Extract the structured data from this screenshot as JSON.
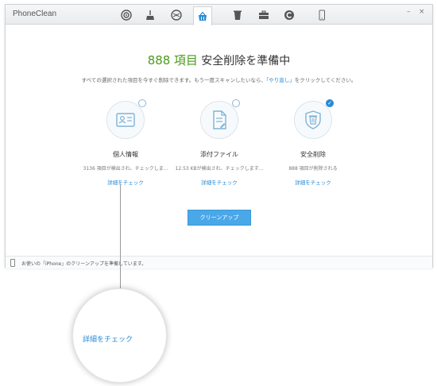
{
  "app": {
    "title": "PhoneClean"
  },
  "toolbar": {
    "tools": [
      {
        "icon": "target-icon"
      },
      {
        "icon": "broom-icon"
      },
      {
        "icon": "globe-icon"
      },
      {
        "icon": "basket-icon",
        "active": true
      },
      {
        "icon": "trash-icon"
      },
      {
        "icon": "toolbox-icon"
      },
      {
        "icon": "refresh-c-icon"
      }
    ],
    "device_icon": "phone-icon",
    "window_controls": {
      "minimize": "–",
      "close": "×"
    }
  },
  "headline": {
    "count": "888",
    "unit": "項目",
    "text": "安全削除を準備中"
  },
  "subtitle": {
    "before": "すべての選択された項目を今すぐ削除できます。もう一度スキャンしたいなら、",
    "link": "「やり直し」",
    "after": "をクリックしてください。"
  },
  "columns": [
    {
      "title": "個人情報",
      "desc": "3136 項目が検出され、チェックしま...",
      "link": "詳細をチェック",
      "icon": "contact-card-icon",
      "checked": false
    },
    {
      "title": "添付ファイル",
      "desc": "12.53 KBが検出され、チェックします...",
      "link": "詳細をチェック",
      "icon": "document-icon",
      "checked": false
    },
    {
      "title": "安全削除",
      "desc": "888 項目が削除される",
      "link": "詳細をチェック",
      "icon": "shield-trash-icon",
      "checked": true
    }
  ],
  "clean_button": "クリーンアップ",
  "status": {
    "text": "お使いの「iPhone」のクリーンアップを準備しています。"
  },
  "zoom": {
    "text": "詳細をチェック"
  },
  "colors": {
    "accent": "#2a8ad4",
    "button": "#4aa8e8",
    "count": "#4a9a1a"
  }
}
